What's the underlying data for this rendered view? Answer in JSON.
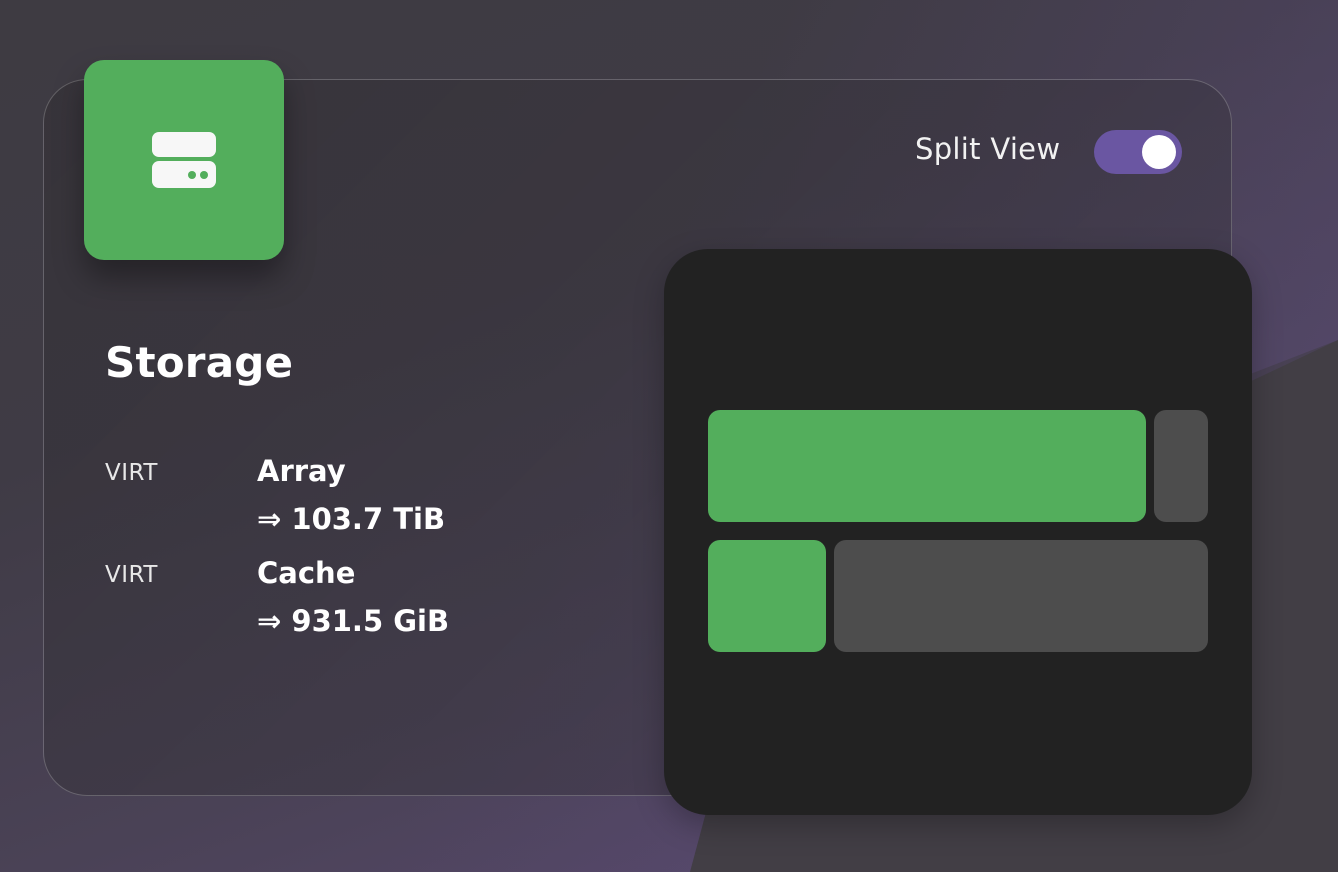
{
  "header": {
    "toggle_label": "Split View",
    "toggle_on": true
  },
  "card": {
    "icon": "server-drive-icon",
    "title": "Storage"
  },
  "storage_rows": [
    {
      "type": "VIRT",
      "name": "Array",
      "value": "⇒ 103.7 TiB",
      "used_fraction": 0.89
    },
    {
      "type": "VIRT",
      "name": "Cache",
      "value": "⇒ 931.5 GiB",
      "used_fraction": 0.24
    }
  ],
  "colors": {
    "accent_green": "#53ae5c",
    "toggle_purple": "#6a56a2",
    "panel_bg": "#222222",
    "free_gray": "#4d4d4d"
  }
}
